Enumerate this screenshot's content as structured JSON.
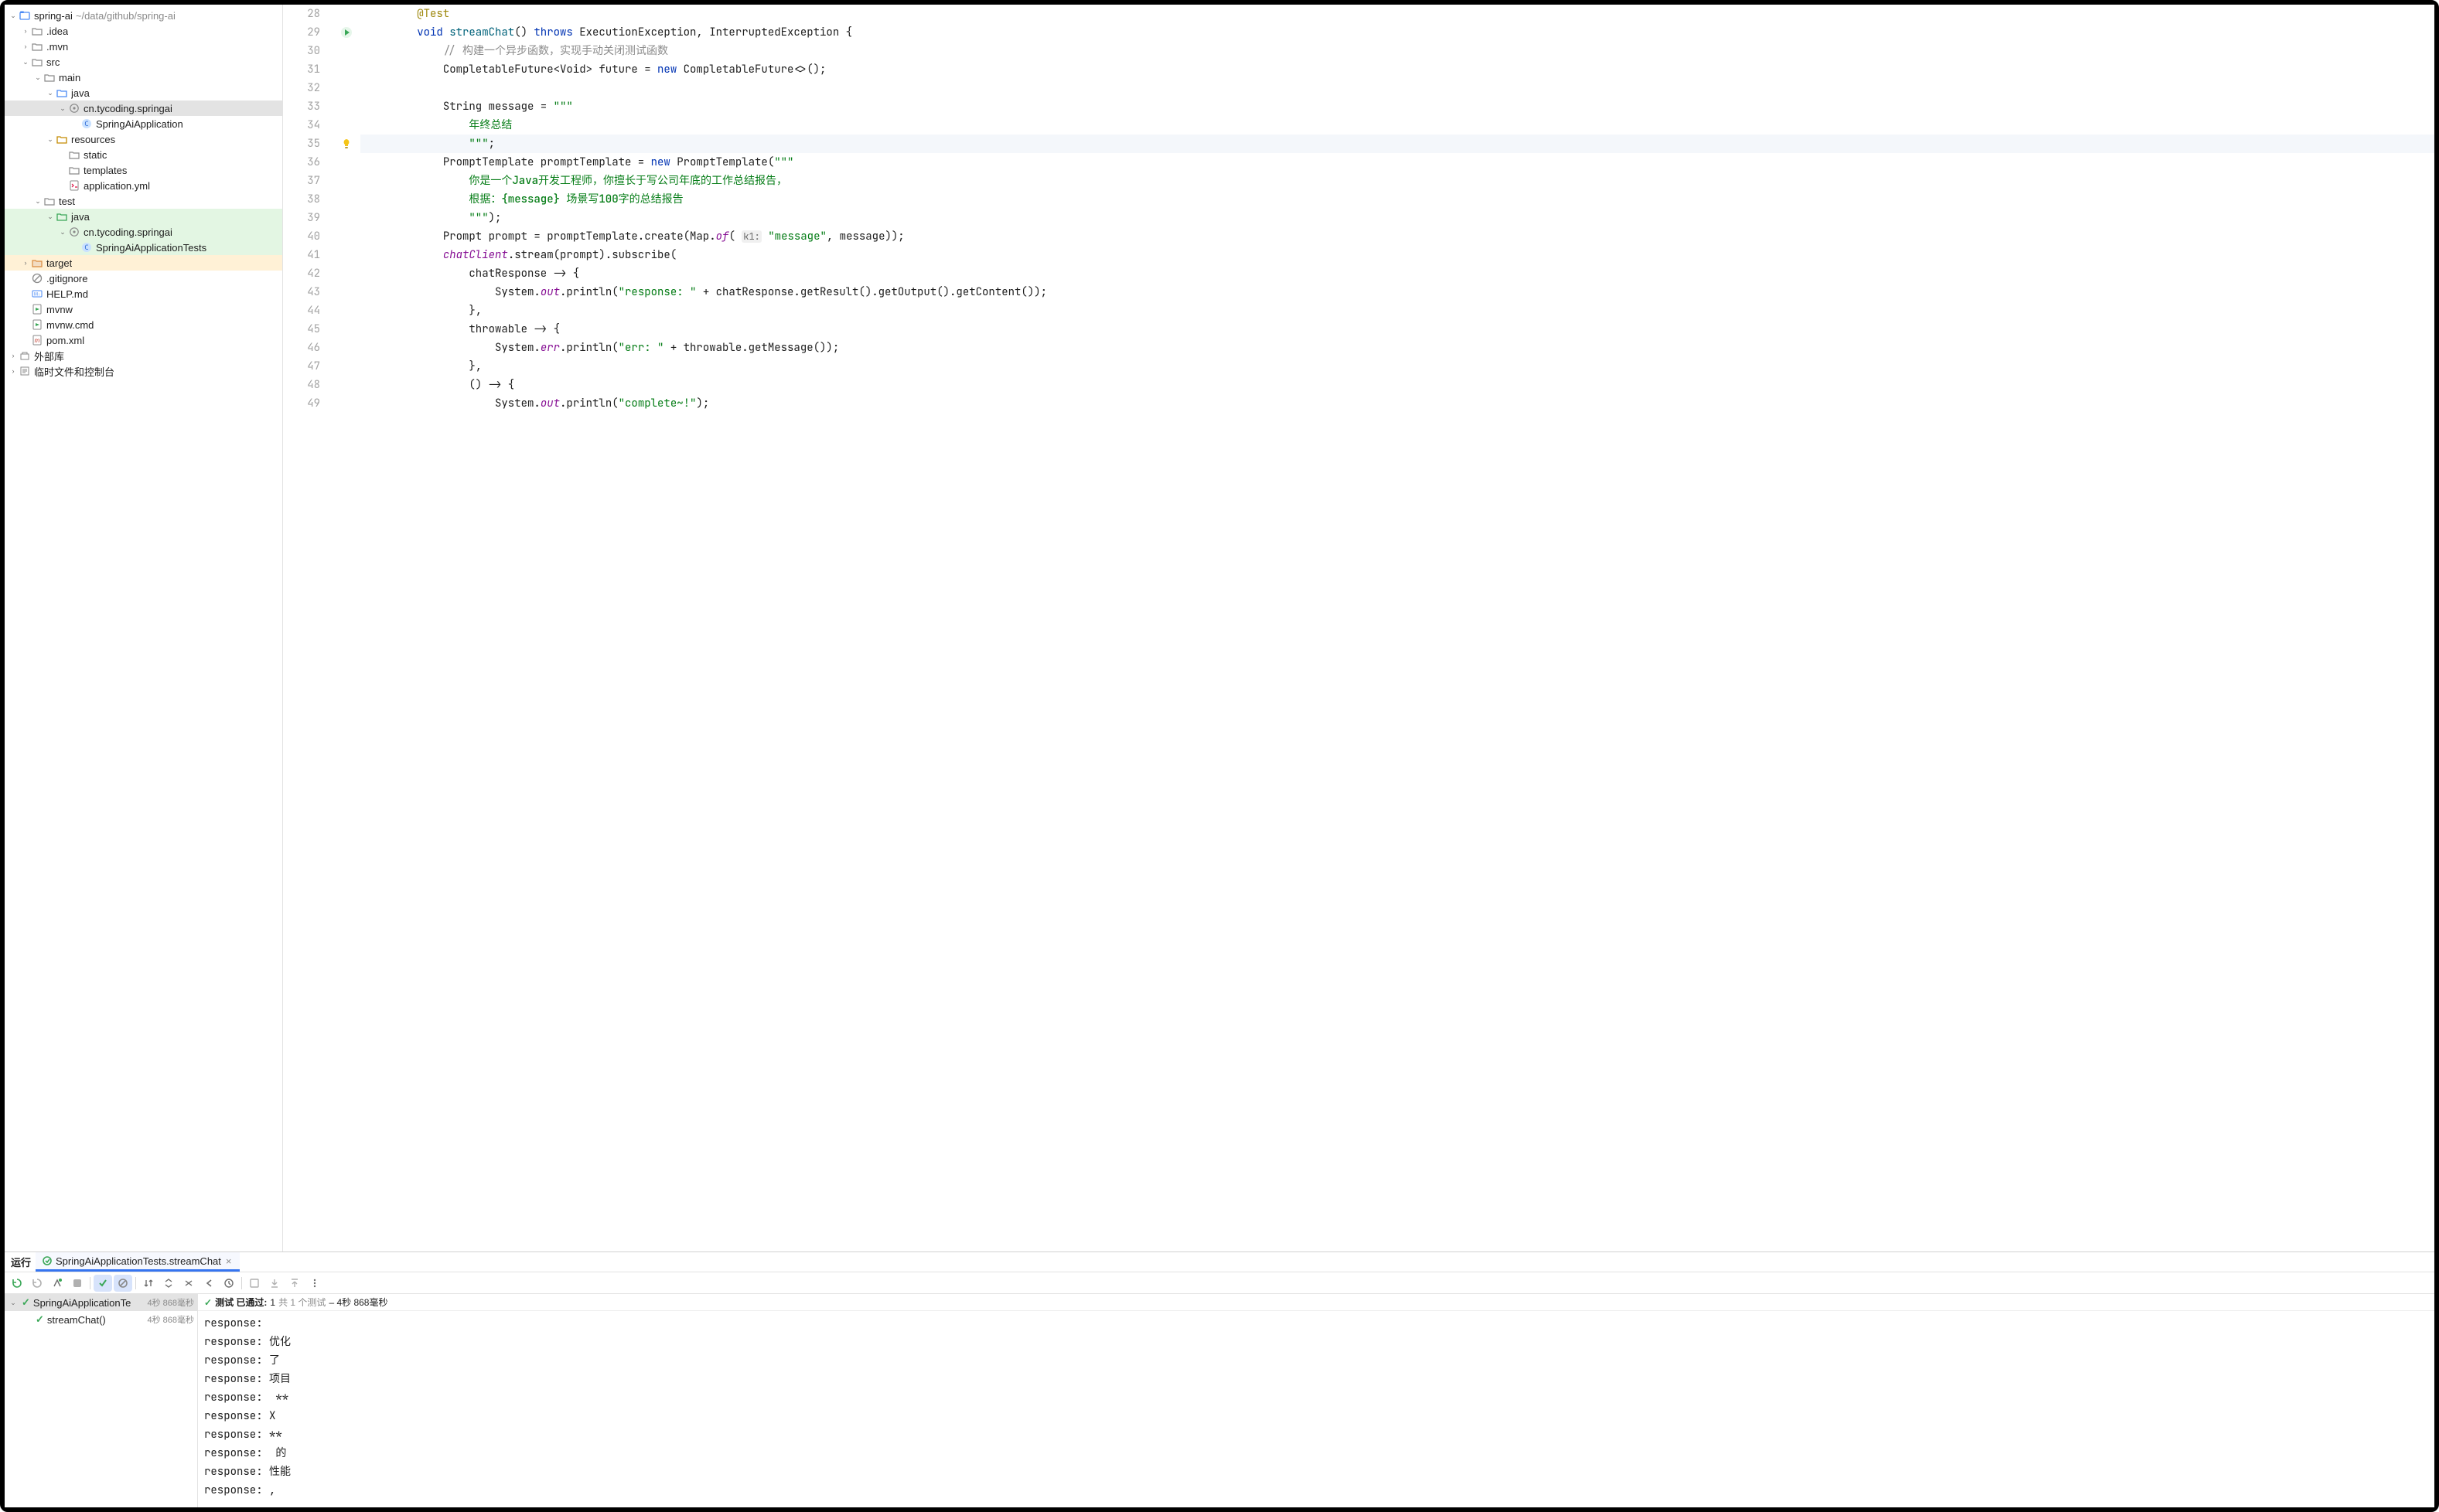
{
  "project": {
    "name": "spring-ai",
    "path": "~/data/github/spring-ai"
  },
  "tree": [
    {
      "d": 0,
      "exp": true,
      "icon": "module",
      "label": "spring-ai",
      "hint": "~/data/github/spring-ai"
    },
    {
      "d": 1,
      "exp": false,
      "icon": "folder",
      "label": ".idea"
    },
    {
      "d": 1,
      "exp": false,
      "icon": "folder",
      "label": ".mvn"
    },
    {
      "d": 1,
      "exp": true,
      "icon": "folder",
      "label": "src"
    },
    {
      "d": 2,
      "exp": true,
      "icon": "folder",
      "label": "main"
    },
    {
      "d": 3,
      "exp": true,
      "icon": "folder-src",
      "label": "java"
    },
    {
      "d": 4,
      "exp": true,
      "icon": "package",
      "label": "cn.tycoding.springai",
      "sel": true
    },
    {
      "d": 5,
      "icon": "class",
      "label": "SpringAiApplication"
    },
    {
      "d": 3,
      "exp": true,
      "icon": "folder-res",
      "label": "resources"
    },
    {
      "d": 4,
      "icon": "folder",
      "label": "static"
    },
    {
      "d": 4,
      "icon": "folder",
      "label": "templates"
    },
    {
      "d": 4,
      "icon": "yaml",
      "label": "application.yml"
    },
    {
      "d": 2,
      "exp": true,
      "icon": "folder",
      "label": "test"
    },
    {
      "d": 3,
      "exp": true,
      "icon": "folder-test",
      "label": "java",
      "cls": "added"
    },
    {
      "d": 4,
      "exp": true,
      "icon": "package",
      "label": "cn.tycoding.springai",
      "cls": "added"
    },
    {
      "d": 5,
      "icon": "class",
      "label": "SpringAiApplicationTests",
      "cls": "added"
    },
    {
      "d": 1,
      "exp": false,
      "icon": "folder-excl",
      "label": "target",
      "cls": "changed"
    },
    {
      "d": 1,
      "icon": "gitignore",
      "label": ".gitignore"
    },
    {
      "d": 1,
      "icon": "markdown",
      "label": "HELP.md"
    },
    {
      "d": 1,
      "icon": "run",
      "label": "mvnw"
    },
    {
      "d": 1,
      "icon": "run",
      "label": "mvnw.cmd"
    },
    {
      "d": 1,
      "icon": "pom",
      "label": "pom.xml"
    },
    {
      "d": 0,
      "exp": false,
      "icon": "ext-lib",
      "label": "外部库"
    },
    {
      "d": 0,
      "exp": false,
      "icon": "scratch",
      "label": "临时文件和控制台"
    }
  ],
  "editor": {
    "first_line": 28,
    "highlight_line": 35,
    "run_gutter_line": 29,
    "bulb_line": 35,
    "lines": [
      {
        "n": 28,
        "i": 2,
        "tokens": [
          {
            "t": "@Test",
            "c": "ann"
          }
        ]
      },
      {
        "n": 29,
        "i": 2,
        "tokens": [
          {
            "t": "void ",
            "c": "kw"
          },
          {
            "t": "streamChat",
            "c": "mtd"
          },
          {
            "t": "() "
          },
          {
            "t": "throws ",
            "c": "kw"
          },
          {
            "t": "ExecutionException, InterruptedException {"
          }
        ]
      },
      {
        "n": 30,
        "i": 3,
        "tokens": [
          {
            "t": "// 构建一个异步函数，实现手动关闭测试函数",
            "c": "cmt"
          }
        ]
      },
      {
        "n": 31,
        "i": 3,
        "tokens": [
          {
            "t": "CompletableFuture<Void> future = "
          },
          {
            "t": "new ",
            "c": "kw"
          },
          {
            "t": "CompletableFuture<>();"
          }
        ]
      },
      {
        "n": 32,
        "i": 3,
        "tokens": []
      },
      {
        "n": 33,
        "i": 3,
        "tokens": [
          {
            "t": "String message = "
          },
          {
            "t": "\"\"\"",
            "c": "str"
          }
        ]
      },
      {
        "n": 34,
        "i": 4,
        "tokens": [
          {
            "t": "年终总结",
            "c": "strb"
          }
        ]
      },
      {
        "n": 35,
        "i": 4,
        "tokens": [
          {
            "t": "\"\"\"",
            "c": "str"
          },
          {
            "t": ";"
          }
        ]
      },
      {
        "n": 36,
        "i": 3,
        "tokens": [
          {
            "t": "PromptTemplate promptTemplate = "
          },
          {
            "t": "new ",
            "c": "kw"
          },
          {
            "t": "PromptTemplate("
          },
          {
            "t": "\"\"\"",
            "c": "str"
          }
        ]
      },
      {
        "n": 37,
        "i": 4,
        "tokens": [
          {
            "t": "你是一个Java开发工程师，你擅长于写公司年底的工作总结报告，",
            "c": "strb"
          }
        ]
      },
      {
        "n": 38,
        "i": 4,
        "tokens": [
          {
            "t": "根据：{message} 场景写100字的总结报告",
            "c": "strb"
          }
        ]
      },
      {
        "n": 39,
        "i": 4,
        "tokens": [
          {
            "t": "\"\"\"",
            "c": "str"
          },
          {
            "t": ");"
          }
        ]
      },
      {
        "n": 40,
        "i": 3,
        "tokens": [
          {
            "t": "Prompt prompt = promptTemplate.create(Map."
          },
          {
            "t": "of",
            "c": "stat"
          },
          {
            "t": "( "
          },
          {
            "t": "k1:",
            "c": "hint"
          },
          {
            "t": " "
          },
          {
            "t": "\"message\"",
            "c": "str"
          },
          {
            "t": ", message));"
          }
        ]
      },
      {
        "n": 41,
        "i": 3,
        "tokens": [
          {
            "t": "chatClient",
            "c": "fld"
          },
          {
            "t": ".stream(prompt).subscribe("
          }
        ]
      },
      {
        "n": 42,
        "i": 4,
        "tokens": [
          {
            "t": "chatResponse -> {"
          }
        ]
      },
      {
        "n": 43,
        "i": 5,
        "tokens": [
          {
            "t": "System."
          },
          {
            "t": "out",
            "c": "stat"
          },
          {
            "t": ".println("
          },
          {
            "t": "\"response: \"",
            "c": "str"
          },
          {
            "t": " + chatResponse.getResult().getOutput().getContent());"
          }
        ]
      },
      {
        "n": 44,
        "i": 4,
        "tokens": [
          {
            "t": "},"
          }
        ]
      },
      {
        "n": 45,
        "i": 4,
        "tokens": [
          {
            "t": "throwable -> {"
          }
        ]
      },
      {
        "n": 46,
        "i": 5,
        "tokens": [
          {
            "t": "System."
          },
          {
            "t": "err",
            "c": "stat"
          },
          {
            "t": ".println("
          },
          {
            "t": "\"err: \"",
            "c": "str"
          },
          {
            "t": " + throwable.getMessage());"
          }
        ]
      },
      {
        "n": 47,
        "i": 4,
        "tokens": [
          {
            "t": "},"
          }
        ]
      },
      {
        "n": 48,
        "i": 4,
        "tokens": [
          {
            "t": "() -> {"
          }
        ]
      },
      {
        "n": 49,
        "i": 5,
        "tokens": [
          {
            "t": "System."
          },
          {
            "t": "out",
            "c": "stat"
          },
          {
            "t": ".println("
          },
          {
            "t": "\"complete~!\"",
            "c": "str"
          },
          {
            "t": ");"
          }
        ]
      }
    ]
  },
  "run": {
    "tool_label": "运行",
    "tab": "SpringAiApplicationTests.streamChat",
    "toolbar": {
      "rerun": "重新运行",
      "rerun_failed": "重新运行失败",
      "toggle_auto": "切换自动测试",
      "stop": "停止",
      "show_passed": "显示通过",
      "show_ignored": "显示忽略",
      "sort": "排序",
      "expand": "全部展开",
      "collapse": "全部折叠",
      "prev": "上一个",
      "history": "历史",
      "import": "导入",
      "export": "导出",
      "more": "更多"
    },
    "tests": [
      {
        "name": "SpringAiApplicationTe",
        "time": "4秒 868毫秒",
        "sel": true,
        "exp": true
      },
      {
        "name": "streamChat()",
        "time": "4秒 868毫秒",
        "child": true
      }
    ],
    "status": {
      "prefix": "✓",
      "bold": "测试 已通过:",
      "mid": "1",
      "muted": "共 1 个测试",
      "tail": " – 4秒 868毫秒"
    },
    "console": [
      "response: ",
      "response: 优化",
      "response: 了",
      "response: 项目",
      "response:  **",
      "response: X",
      "response: **",
      "response:  的",
      "response: 性能",
      "response: ,"
    ]
  }
}
